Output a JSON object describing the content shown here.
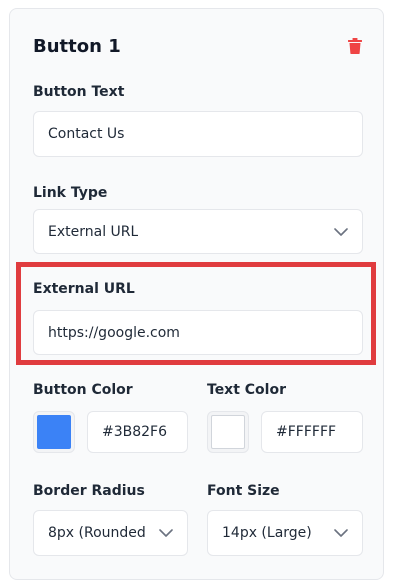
{
  "panel": {
    "title": "Button 1",
    "delete_icon": "trash-icon",
    "delete_color": "#ef4444"
  },
  "button_text": {
    "label": "Button Text",
    "value": "Contact Us"
  },
  "link_type": {
    "label": "Link Type",
    "selected": "External URL"
  },
  "external_url": {
    "label": "External URL",
    "value": "https://google.com",
    "highlight_color": "#e03c3f"
  },
  "button_color": {
    "label": "Button Color",
    "value": "#3B82F6",
    "swatch": "#3B82F6"
  },
  "text_color": {
    "label": "Text Color",
    "value": "#FFFFFF",
    "swatch": "#FFFFFF"
  },
  "border_radius": {
    "label": "Border Radius",
    "selected": "8px (Rounded"
  },
  "font_size": {
    "label": "Font Size",
    "selected": "14px (Large)"
  }
}
